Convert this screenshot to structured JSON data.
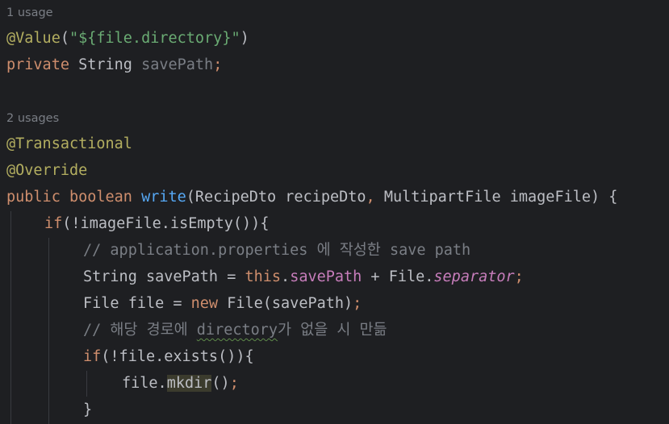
{
  "usage_hints": {
    "field_usages": "1 usage",
    "method_usages": "2 usages"
  },
  "code": {
    "l1_annotation": "@Value",
    "l1_paren_open": "(",
    "l1_string": "\"${file.directory}\"",
    "l1_paren_close": ")",
    "l2_modifier": "private",
    "l2_type": " String ",
    "l2_field": "savePath",
    "l2_semicolon": ";",
    "l3_annotation": "@Transactional",
    "l4_annotation": "@Override",
    "l5_public": "public",
    "l5_boolean": " boolean ",
    "l5_method": "write",
    "l5_params": "(RecipeDto recipeDto",
    "l5_comma": ",",
    "l5_params2": " MultipartFile imageFile) {",
    "l6_if": "if",
    "l6_cond": "(!imageFile.isEmpty()){",
    "l7_comment": "// application.properties 에 작성한 save path",
    "l8_decl": "String savePath = ",
    "l8_this": "this",
    "l8_dot": ".",
    "l8_field": "savePath",
    "l8_plus": " + File.",
    "l8_static": "separator",
    "l8_semicolon": ";",
    "l9_decl": "File file = ",
    "l9_new": "new",
    "l9_ctor": " File(savePath)",
    "l9_semicolon": ";",
    "l10_comment_a": "// 해당 경로에 ",
    "l10_comment_typo": "directory",
    "l10_comment_b": "가 없을 시 만듦",
    "l11_if": "if",
    "l11_cond": "(!file.exists()){",
    "l12_obj": "file.",
    "l12_method": "mkdir",
    "l12_call": "()",
    "l12_semicolon": ";",
    "l13_brace": "}"
  },
  "colors": {
    "background": "#1e1f22",
    "default_text": "#bcbec4",
    "keyword": "#cf8e6d",
    "annotation": "#b3ae60",
    "string": "#6aab73",
    "method_declaration": "#56a8f5",
    "field": "#c77dbb",
    "comment": "#7a7e85",
    "indent_guide": "#393b40"
  }
}
